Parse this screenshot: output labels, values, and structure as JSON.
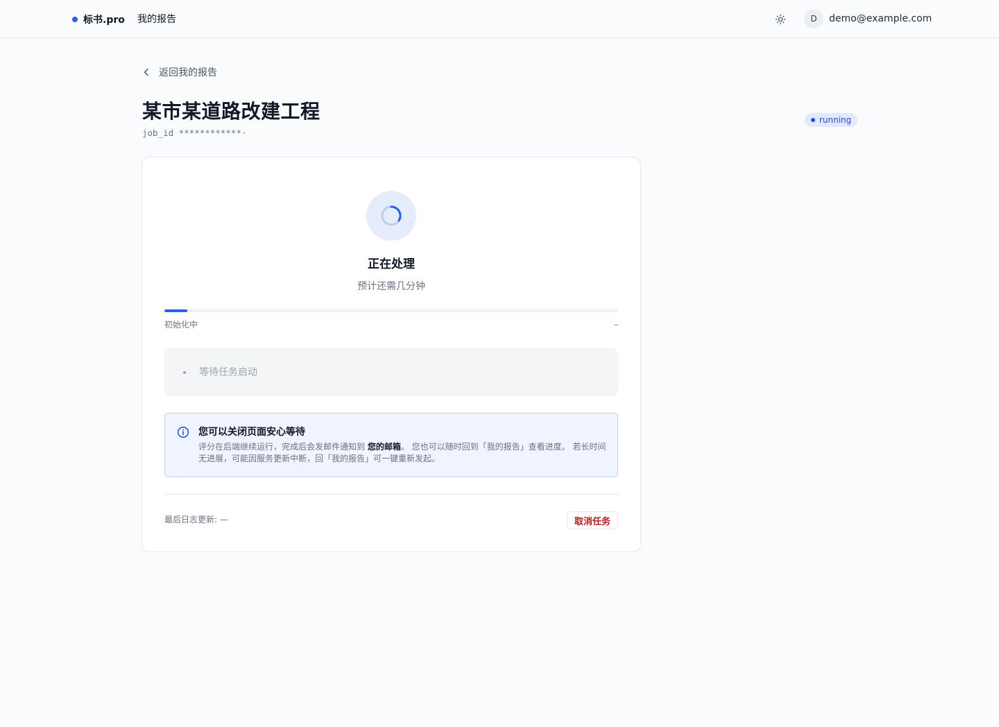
{
  "header": {
    "brand": "标书.pro",
    "nav_reports": "我的报告",
    "avatar_initial": "D",
    "user_email": "demo@example.com"
  },
  "page": {
    "back_link": "返回我的报告",
    "title": "某市某道路改建工程",
    "job_id": "job_id ************·",
    "status": "running"
  },
  "card": {
    "proc_title": "正在处理",
    "proc_sub": "预计还需几分钟",
    "progress_fraction": 0.05,
    "stage_label": "初始化中",
    "stage_value": "–",
    "log_entry": "等待任务启动",
    "info": {
      "title": "您可以关闭页面安心等待",
      "body_prefix": "评分在后端继续运行，完成后会发邮件通知到 ",
      "body_email": "您的邮箱",
      "body_suffix": "。 您也可以随时回到「我的报告」查看进度。 若长时间无进展，可能因服务更新中断，回「我的报告」可一键重新发起。"
    },
    "last_update": "最后日志更新: —",
    "cancel_label": "取消任务"
  },
  "colors": {
    "accent": "#2563eb",
    "danger": "#b91c1c",
    "badge_bg": "#e3e9fb"
  }
}
